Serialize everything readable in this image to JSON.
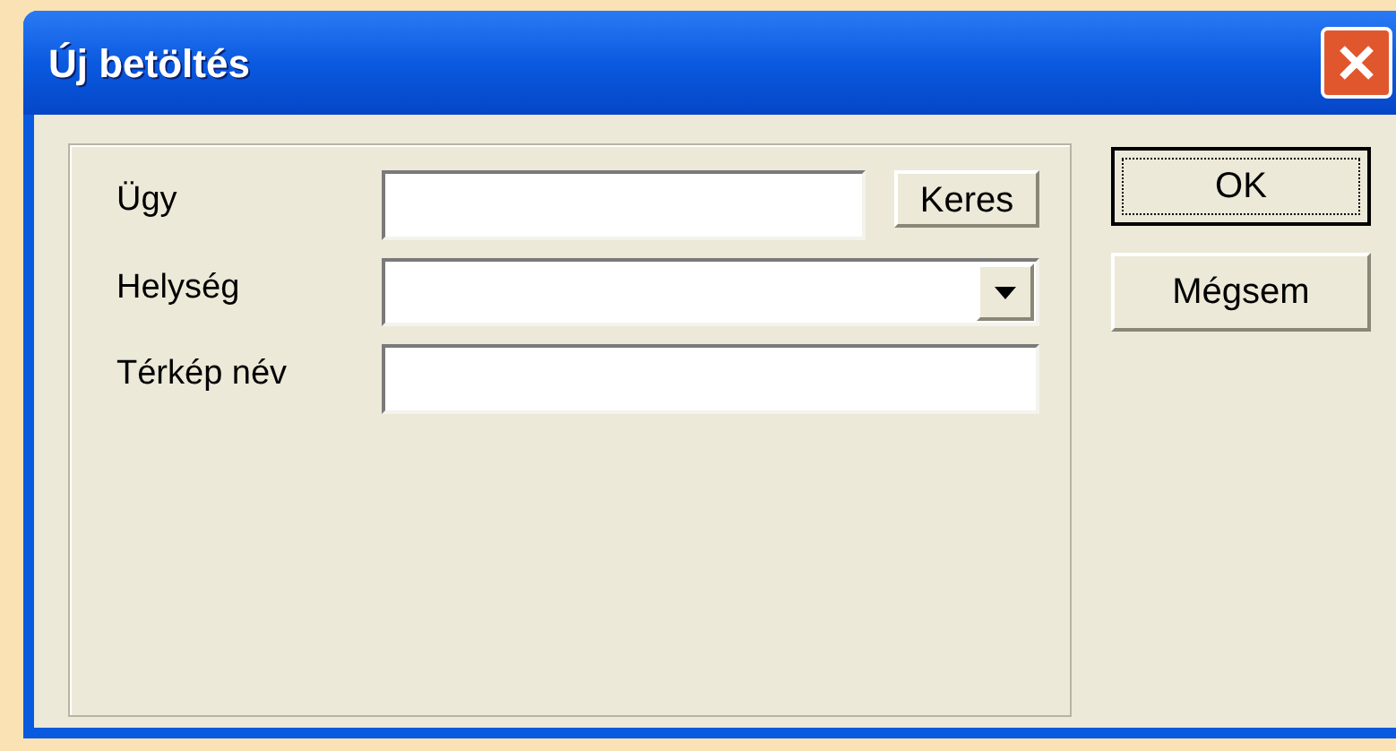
{
  "window": {
    "title": "Új betöltés"
  },
  "fields": [
    {
      "label": "Ügy",
      "kind": "text",
      "button": "Keres"
    },
    {
      "label": "Helység",
      "kind": "combo"
    },
    {
      "label": "Térkép név",
      "kind": "text"
    }
  ],
  "buttons": [
    {
      "label": "OK",
      "default": true
    },
    {
      "label": "Mégsem",
      "default": false
    }
  ]
}
